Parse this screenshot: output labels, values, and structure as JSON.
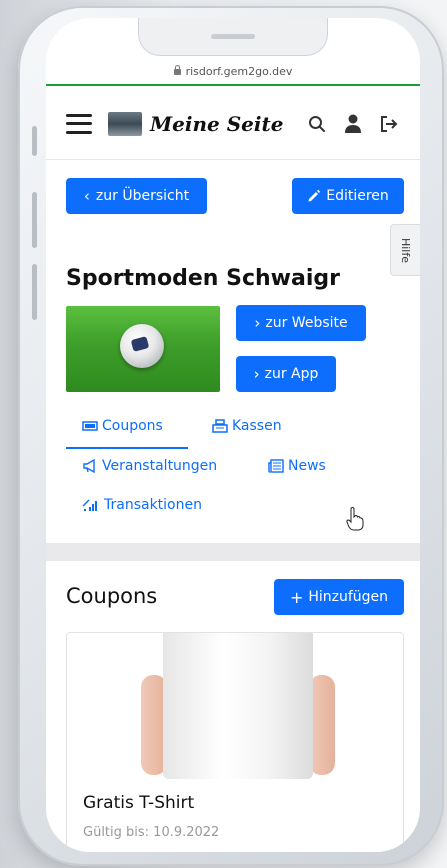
{
  "browser": {
    "url": "risdorf.gem2go.dev"
  },
  "navbar": {
    "site_name": "Meine Seite",
    "icons": [
      "menu-icon",
      "search-icon",
      "user-icon",
      "logout-icon"
    ]
  },
  "toolbar": {
    "back_label": "zur Übersicht",
    "edit_label": "Editieren",
    "help_label": "Hilfe"
  },
  "shop": {
    "title": "Sportmoden Schwaigr",
    "website_label": "zur Website",
    "app_label": "zur App"
  },
  "tabs": [
    {
      "label": "Coupons",
      "icon": "ticket-icon",
      "active": true
    },
    {
      "label": "Kassen",
      "icon": "cash-register-icon",
      "active": false
    },
    {
      "label": "Veranstaltungen",
      "icon": "megaphone-icon",
      "active": false
    },
    {
      "label": "News",
      "icon": "newspaper-icon",
      "active": false
    },
    {
      "label": "Transaktionen",
      "icon": "transactions-icon",
      "active": false
    }
  ],
  "coupons": {
    "title": "Coupons",
    "add_label": "Hinzufügen",
    "items": [
      {
        "title": "Gratis T-Shirt",
        "valid_until": "Gültig bis: 10.9.2022"
      }
    ]
  },
  "colors": {
    "accent": "#0d6efd",
    "url_bar_line": "#1a9e3a"
  }
}
